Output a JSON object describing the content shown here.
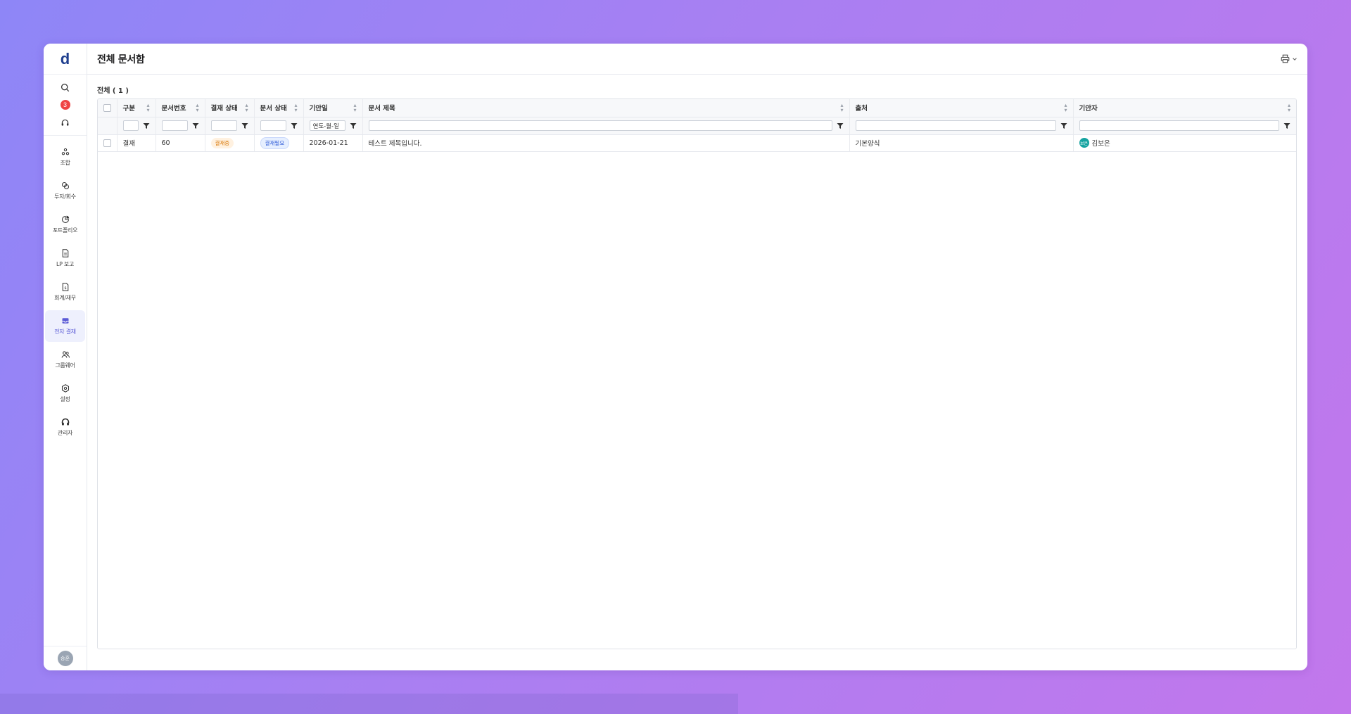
{
  "sidebar": {
    "logo": "d",
    "notification_count": "3",
    "items": [
      {
        "label": "조합"
      },
      {
        "label": "투자/회수"
      },
      {
        "label": "포트폴리오"
      },
      {
        "label": "LP 보고"
      },
      {
        "label": "회계/재무"
      },
      {
        "label": "전자 결재"
      },
      {
        "label": "그룹웨어"
      },
      {
        "label": "설정"
      },
      {
        "label": "관리자"
      }
    ],
    "user_avatar": "승훈"
  },
  "header": {
    "title": "전체 문서함"
  },
  "count_label": "전체 ( 1 )",
  "table": {
    "columns": [
      "구분",
      "문서번호",
      "결재 상태",
      "문서 상태",
      "기안일",
      "문서 제목",
      "출처",
      "기안자"
    ],
    "date_filter_placeholder": "연도-월-일",
    "rows": [
      {
        "category": "결재",
        "doc_no": "60",
        "approval_status": "결재중",
        "doc_status": "결재필요",
        "draft_date": "2026-01-21",
        "title": "테스트 제목입니다.",
        "source": "기본양식",
        "drafter_avatar": "보은",
        "drafter": "김보은"
      }
    ]
  },
  "colors": {
    "accent": "#5b5bd6",
    "badge_red": "#ef4444",
    "approval_pill": "#d97706",
    "status_pill": "#2f5bd8",
    "drafter_avatar": "#15a3a0"
  }
}
